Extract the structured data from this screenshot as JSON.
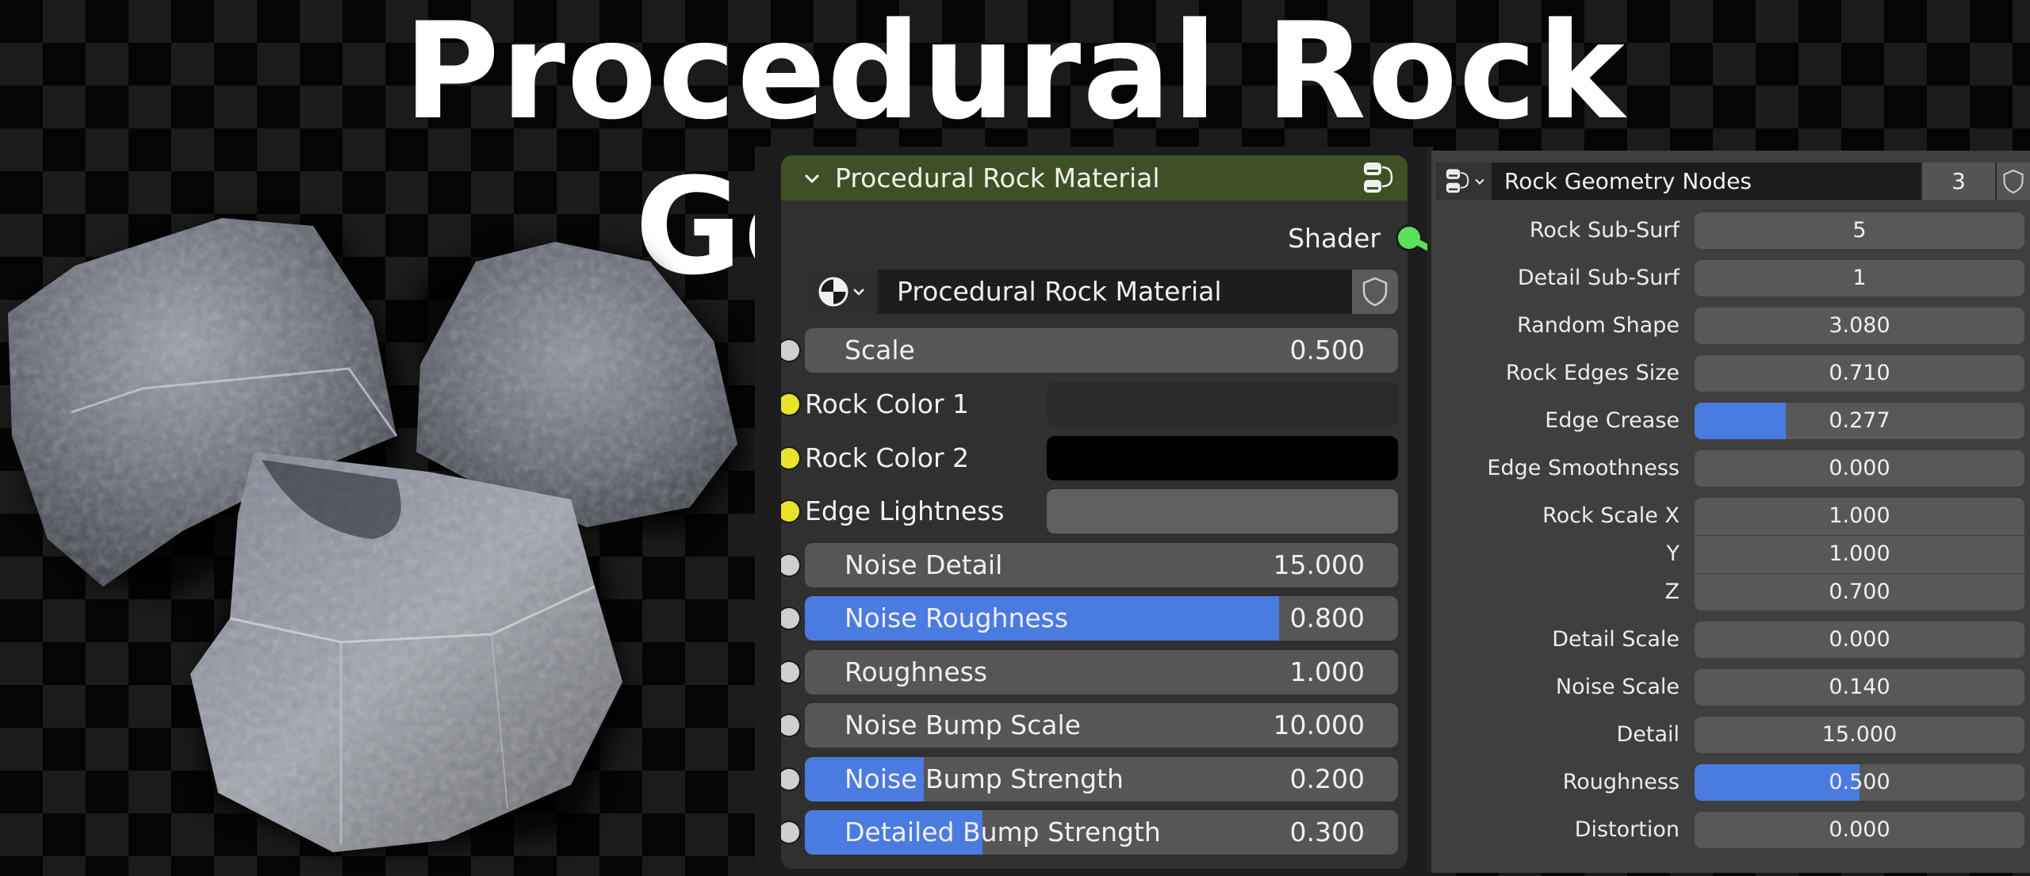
{
  "title": "Procedural Rock Generator",
  "preview": {
    "image": "three-procedural-rocks-render",
    "background": "transparency-checkerboard"
  },
  "node": {
    "header_title": "Procedural Rock Material",
    "header_color": "#3d5026",
    "node_group_icon": "node-tree-icon",
    "output_socket": {
      "label": "Shader",
      "color": "#5ce05c"
    },
    "material_selector": {
      "value": "Procedural Rock Material",
      "icon": "material-sphere-icon",
      "fake_user_icon": "shield-icon"
    },
    "inputs": [
      {
        "label": "Scale",
        "value": "0.500",
        "type": "float",
        "socket": "grey",
        "fill": 0
      },
      {
        "label": "Rock Color 1",
        "type": "color",
        "socket": "yellow",
        "color": "#2a2a2a"
      },
      {
        "label": "Rock Color 2",
        "type": "color",
        "socket": "yellow",
        "color": "#000000"
      },
      {
        "label": "Edge Lightness",
        "type": "color",
        "socket": "yellow",
        "color": "#5f5f5f"
      },
      {
        "label": "Noise Detail",
        "value": "15.000",
        "type": "float",
        "socket": "grey",
        "fill": 0
      },
      {
        "label": "Noise Roughness",
        "value": "0.800",
        "type": "factor",
        "socket": "grey",
        "fill": 0.8
      },
      {
        "label": "Roughness",
        "value": "1.000",
        "type": "float",
        "socket": "grey",
        "fill": 0
      },
      {
        "label": "Noise Bump Scale",
        "value": "10.000",
        "type": "float",
        "socket": "grey",
        "fill": 0
      },
      {
        "label": "Noise Bump Strength",
        "value": "0.200",
        "type": "factor",
        "socket": "grey",
        "fill": 0.2
      },
      {
        "label": "Detailed Bump Strength",
        "value": "0.300",
        "type": "factor",
        "socket": "grey",
        "fill": 0.3
      }
    ]
  },
  "modifier": {
    "node_group_name": "Rock Geometry Nodes",
    "users": "3",
    "node_group_icon": "node-tree-icon",
    "fake_user_icon": "shield-icon",
    "accent": "#4a7be0",
    "params": [
      {
        "label": "Rock Sub-Surf",
        "value": "5",
        "fill": 0
      },
      {
        "label": "Detail Sub-Surf",
        "value": "1",
        "fill": 0
      },
      {
        "label": "Random Shape",
        "value": "3.080",
        "fill": 0
      },
      {
        "label": "Rock Edges Size",
        "value": "0.710",
        "fill": 0
      },
      {
        "label": "Edge Crease",
        "value": "0.277",
        "fill": 0.277
      },
      {
        "label": "Edge Smoothness",
        "value": "0.000",
        "fill": 0
      },
      {
        "label": "Rock Scale X",
        "value": "1.000",
        "fill": 0
      },
      {
        "label": "Y",
        "value": "1.000",
        "fill": 0
      },
      {
        "label": "Z",
        "value": "0.700",
        "fill": 0
      },
      {
        "label": "Detail Scale",
        "value": "0.000",
        "fill": 0
      },
      {
        "label": "Noise Scale",
        "value": "0.140",
        "fill": 0
      },
      {
        "label": "Detail",
        "value": "15.000",
        "fill": 0
      },
      {
        "label": "Roughness",
        "value": "0.500",
        "fill": 0.5
      },
      {
        "label": "Distortion",
        "value": "0.000",
        "fill": 0
      }
    ]
  }
}
